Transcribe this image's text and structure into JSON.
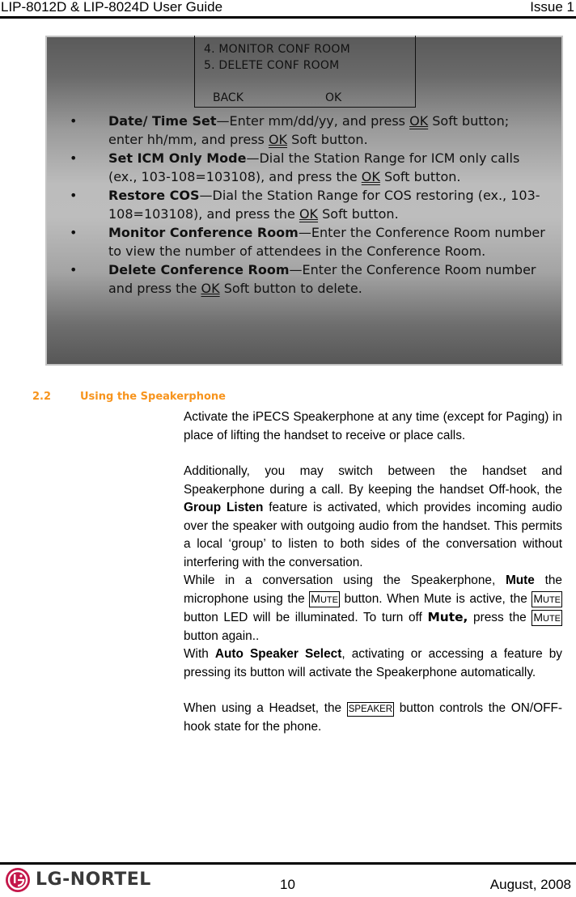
{
  "header": {
    "left": "LIP-8012D & LIP-8024D User Guide",
    "right": "Issue 1"
  },
  "lcd": {
    "line1": "4. MONITOR CONF ROOM",
    "line2": "5. DELETE CONF ROOM",
    "softkey_left": "BACK",
    "softkey_right": "OK"
  },
  "bullets": [
    {
      "title": "Date/ Time Set",
      "p1": "—Enter mm/dd/yy, and press ",
      "ok1": "OK",
      "p2": " Soft button; enter hh/mm, and press ",
      "ok2": "OK",
      "p3": " Soft button."
    },
    {
      "title": "Set ICM Only Mode",
      "p1": "—Dial the Station Range for ICM only calls (ex., 103-108=103108), and press the ",
      "ok1": "OK",
      "p2": " Soft button."
    },
    {
      "title": "Restore COS",
      "p1": "—Dial the Station Range for COS restoring (ex., 103-108=103108), and press the ",
      "ok1": "OK",
      "p2": " Soft button."
    },
    {
      "title": "Monitor Conference Room",
      "p1": "—Enter the Conference Room number to view the number of attendees in the Conference Room."
    },
    {
      "title": "Delete Conference Room",
      "p1": "—Enter the Conference Room number and press the ",
      "ok1": "OK",
      "p2": " Soft button to delete."
    }
  ],
  "section": {
    "number": "2.2",
    "title": "Using the Speakerphone",
    "color": "#f7941d"
  },
  "paragraphs": {
    "p1": "Activate the iPECS Speakerphone at any time (except for Paging) in place of lifting the handset to receive or place calls.",
    "p2a": "Additionally, you may switch between the handset and Speakerphone during a call.  By keeping the handset Off-hook, the ",
    "p2b": "Group Listen",
    "p2c": " feature is activated, which provides incoming audio over the speaker with outgoing audio from the handset.  This permits a local ‘group’ to listen to both sides of the conversation without interfering with the conversation.",
    "p3a": "While in a conversation using the Speakerphone, ",
    "p3b": "Mute",
    "p3c": " the microphone using the ",
    "p3d": " button.  When Mute is active, the ",
    "p3e": " button LED will be illuminated. To turn off ",
    "p3f": "Mute,",
    "p3g": " press the ",
    "p3h": " button again..",
    "p4a": "With ",
    "p4b": "Auto Speaker Select",
    "p4c": ", activating or accessing a feature by pressing its button will activate the Speakerphone automatically.",
    "p5a": "When using a Headset, the ",
    "p5b": " button controls the ON/OFF-hook state for the phone."
  },
  "keys": {
    "mute_first": "M",
    "mute_rest": "UTE",
    "speaker": "SPEAKER"
  },
  "footer": {
    "logo_text": "LG-NORTEL",
    "page": "10",
    "date": "August, 2008",
    "logo_color": "#c4174a"
  }
}
